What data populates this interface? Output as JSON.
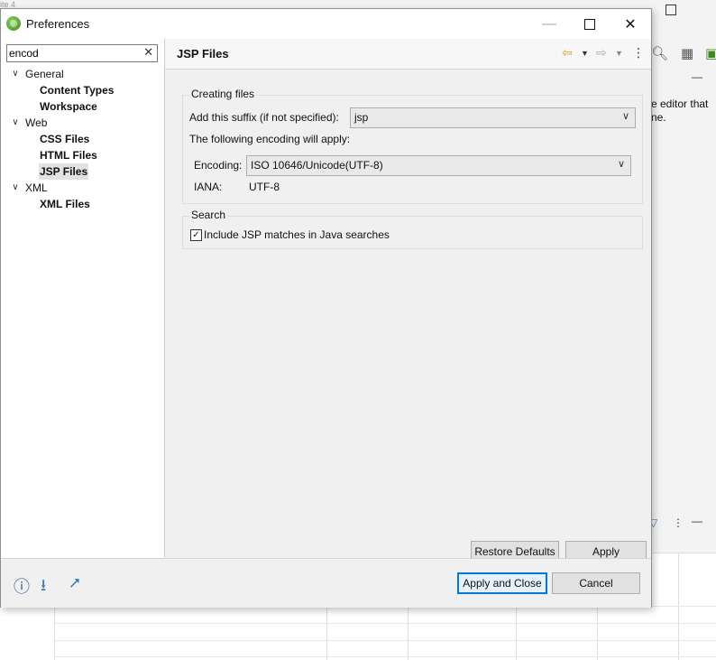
{
  "background_app": {
    "view_text_line1": "e editor that",
    "view_text_line2": "ne."
  },
  "window": {
    "title": "Preferences",
    "minimize_icon": "minimize-icon",
    "maximize_icon": "maximize-icon",
    "close_icon": "close-icon"
  },
  "filter": {
    "value": "encod",
    "clear_glyph": "✕"
  },
  "tree": {
    "general": "General",
    "content_types": "Content Types",
    "workspace": "Workspace",
    "web": "Web",
    "css_files": "CSS Files",
    "html_files": "HTML Files",
    "jsp_files": "JSP Files",
    "xml": "XML",
    "xml_files": "XML Files"
  },
  "page": {
    "title": "JSP Files",
    "creating_files": {
      "group_title": "Creating files",
      "suffix_label": "Add this suffix (if not specified):",
      "suffix_value": "jsp",
      "encoding_info": "The following encoding will apply:",
      "encoding_label": "Encoding:",
      "encoding_value": "ISO 10646/Unicode(UTF-8)",
      "iana_label": "IANA:",
      "iana_value": "UTF-8"
    },
    "search": {
      "group_title": "Search",
      "include_jsp_label": "Include JSP matches in Java searches",
      "include_jsp_checked": true
    },
    "restore_defaults": "Restore Defaults",
    "apply": "Apply"
  },
  "footer": {
    "apply_and_close": "Apply and Close",
    "cancel": "Cancel"
  },
  "colors": {
    "default_button_border": "#0078d7",
    "selected_tree_item": "#e2e2e2",
    "app_icon": "#4caf2a"
  }
}
